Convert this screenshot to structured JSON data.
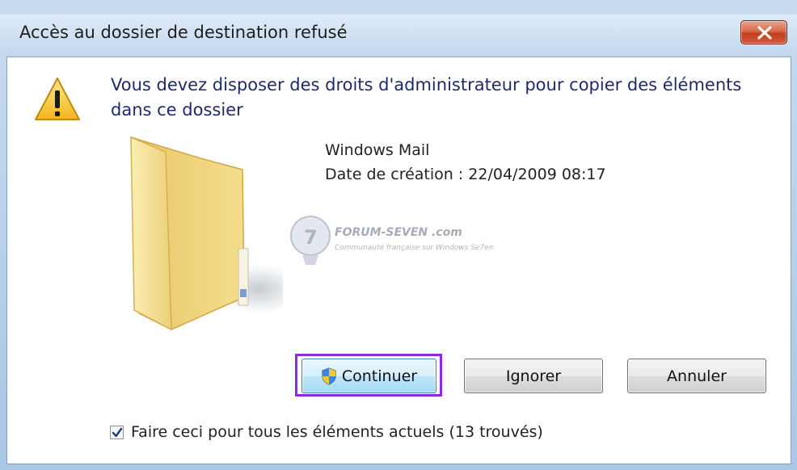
{
  "window": {
    "title": "Accès au dossier de destination refusé",
    "close_icon": "close-x-icon"
  },
  "message": {
    "icon": "warning-triangle-icon",
    "text": "Vous devez disposer des droits d'administrateur pour copier des éléments dans ce dossier"
  },
  "item": {
    "icon": "folder-icon",
    "name": "Windows Mail",
    "date": "Date de création : 22/04/2009 08:17"
  },
  "watermark": {
    "text": "FORUM-SEVEN .com",
    "subtitle": "Communauté française sur Windows Se7en"
  },
  "buttons": {
    "continue_label": "Continuer",
    "continue_icon": "uac-shield-icon",
    "ignore_label": "Ignorer",
    "cancel_label": "Annuler"
  },
  "checkbox": {
    "checked": true,
    "label": "Faire ceci pour tous les éléments actuels (13 trouvés)"
  },
  "colors": {
    "highlight": "#8a2be2",
    "message_text": "#1e2a6b",
    "close_button": "#c33f20"
  }
}
